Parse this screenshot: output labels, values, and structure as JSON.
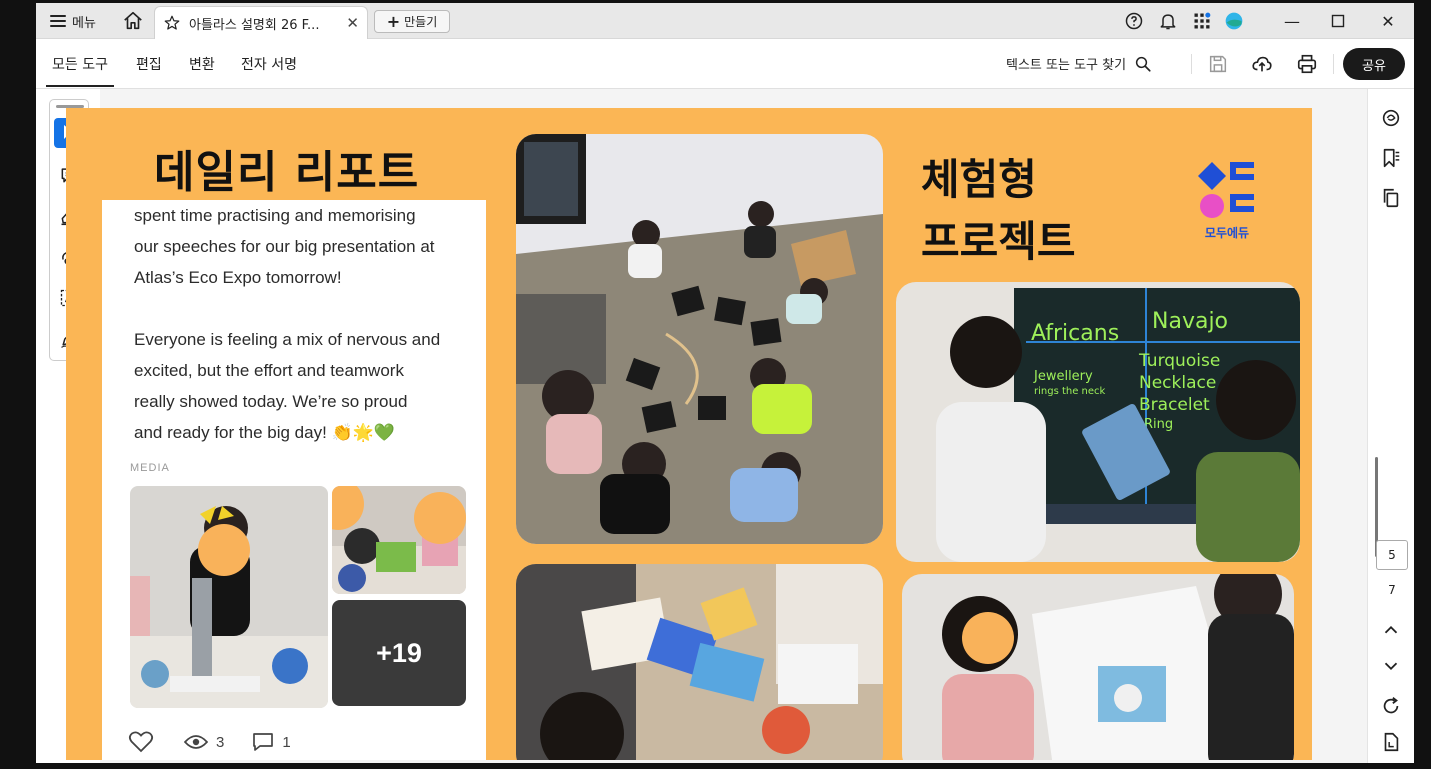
{
  "titlebar": {
    "menu_label": "메뉴",
    "tab_title": "아틀라스 설명회 26 F...",
    "tab_close": "✕",
    "new_label": "만들기",
    "new_plus": "+"
  },
  "toolbar": {
    "tabs": [
      "모든 도구",
      "편집",
      "변환",
      "전자 서명"
    ],
    "find_label": "텍스트 또는 도구 찾기",
    "share_label": "공유"
  },
  "page_nav": {
    "current": "5",
    "total": "7"
  },
  "document": {
    "heading_daily": "데일리 리포트",
    "heading_exp_line1": "체험형",
    "heading_exp_line2": "프로젝트",
    "logo_text": "모두에듀",
    "card": {
      "line1": "spent time practising and memorising",
      "line2": "our speeches for our big presentation at",
      "line3": "Atlas’s Eco Expo tomorrow!",
      "line4": "Everyone is feeling a mix of nervous and",
      "line5": "excited, but the effort and teamwork",
      "line6": "really showed today. We’re so proud",
      "line7": "and ready for the big day! 👏🌟💚",
      "media_label": "MEDIA",
      "more_count": "+19",
      "views": "3",
      "comments": "1"
    },
    "whiteboard": {
      "col1": "Africans",
      "col2": "Navajo",
      "row1a": "Jewellery",
      "row1b": "rings the neck",
      "items": [
        "Turquoise",
        "Necklace",
        "Bracelet",
        "Ring"
      ]
    }
  },
  "colors": {
    "page_bg": "#fbb655",
    "accent": "#1473e6",
    "logo_blue": "#1f4fd6",
    "logo_pink": "#e84fc6"
  }
}
